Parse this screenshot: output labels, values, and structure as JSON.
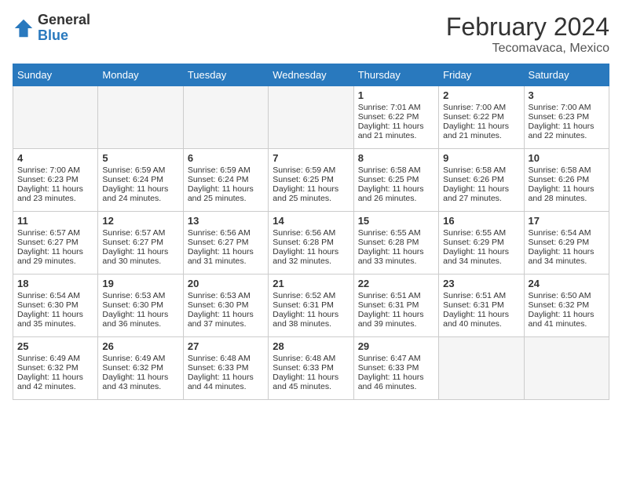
{
  "header": {
    "logo_line1": "General",
    "logo_line2": "Blue",
    "title": "February 2024",
    "subtitle": "Tecomavaca, Mexico"
  },
  "days_of_week": [
    "Sunday",
    "Monday",
    "Tuesday",
    "Wednesday",
    "Thursday",
    "Friday",
    "Saturday"
  ],
  "weeks": [
    [
      {
        "day": "",
        "info": ""
      },
      {
        "day": "",
        "info": ""
      },
      {
        "day": "",
        "info": ""
      },
      {
        "day": "",
        "info": ""
      },
      {
        "day": "1",
        "info": "Sunrise: 7:01 AM\nSunset: 6:22 PM\nDaylight: 11 hours and 21 minutes."
      },
      {
        "day": "2",
        "info": "Sunrise: 7:00 AM\nSunset: 6:22 PM\nDaylight: 11 hours and 21 minutes."
      },
      {
        "day": "3",
        "info": "Sunrise: 7:00 AM\nSunset: 6:23 PM\nDaylight: 11 hours and 22 minutes."
      }
    ],
    [
      {
        "day": "4",
        "info": "Sunrise: 7:00 AM\nSunset: 6:23 PM\nDaylight: 11 hours and 23 minutes."
      },
      {
        "day": "5",
        "info": "Sunrise: 6:59 AM\nSunset: 6:24 PM\nDaylight: 11 hours and 24 minutes."
      },
      {
        "day": "6",
        "info": "Sunrise: 6:59 AM\nSunset: 6:24 PM\nDaylight: 11 hours and 25 minutes."
      },
      {
        "day": "7",
        "info": "Sunrise: 6:59 AM\nSunset: 6:25 PM\nDaylight: 11 hours and 25 minutes."
      },
      {
        "day": "8",
        "info": "Sunrise: 6:58 AM\nSunset: 6:25 PM\nDaylight: 11 hours and 26 minutes."
      },
      {
        "day": "9",
        "info": "Sunrise: 6:58 AM\nSunset: 6:26 PM\nDaylight: 11 hours and 27 minutes."
      },
      {
        "day": "10",
        "info": "Sunrise: 6:58 AM\nSunset: 6:26 PM\nDaylight: 11 hours and 28 minutes."
      }
    ],
    [
      {
        "day": "11",
        "info": "Sunrise: 6:57 AM\nSunset: 6:27 PM\nDaylight: 11 hours and 29 minutes."
      },
      {
        "day": "12",
        "info": "Sunrise: 6:57 AM\nSunset: 6:27 PM\nDaylight: 11 hours and 30 minutes."
      },
      {
        "day": "13",
        "info": "Sunrise: 6:56 AM\nSunset: 6:27 PM\nDaylight: 11 hours and 31 minutes."
      },
      {
        "day": "14",
        "info": "Sunrise: 6:56 AM\nSunset: 6:28 PM\nDaylight: 11 hours and 32 minutes."
      },
      {
        "day": "15",
        "info": "Sunrise: 6:55 AM\nSunset: 6:28 PM\nDaylight: 11 hours and 33 minutes."
      },
      {
        "day": "16",
        "info": "Sunrise: 6:55 AM\nSunset: 6:29 PM\nDaylight: 11 hours and 34 minutes."
      },
      {
        "day": "17",
        "info": "Sunrise: 6:54 AM\nSunset: 6:29 PM\nDaylight: 11 hours and 34 minutes."
      }
    ],
    [
      {
        "day": "18",
        "info": "Sunrise: 6:54 AM\nSunset: 6:30 PM\nDaylight: 11 hours and 35 minutes."
      },
      {
        "day": "19",
        "info": "Sunrise: 6:53 AM\nSunset: 6:30 PM\nDaylight: 11 hours and 36 minutes."
      },
      {
        "day": "20",
        "info": "Sunrise: 6:53 AM\nSunset: 6:30 PM\nDaylight: 11 hours and 37 minutes."
      },
      {
        "day": "21",
        "info": "Sunrise: 6:52 AM\nSunset: 6:31 PM\nDaylight: 11 hours and 38 minutes."
      },
      {
        "day": "22",
        "info": "Sunrise: 6:51 AM\nSunset: 6:31 PM\nDaylight: 11 hours and 39 minutes."
      },
      {
        "day": "23",
        "info": "Sunrise: 6:51 AM\nSunset: 6:31 PM\nDaylight: 11 hours and 40 minutes."
      },
      {
        "day": "24",
        "info": "Sunrise: 6:50 AM\nSunset: 6:32 PM\nDaylight: 11 hours and 41 minutes."
      }
    ],
    [
      {
        "day": "25",
        "info": "Sunrise: 6:49 AM\nSunset: 6:32 PM\nDaylight: 11 hours and 42 minutes."
      },
      {
        "day": "26",
        "info": "Sunrise: 6:49 AM\nSunset: 6:32 PM\nDaylight: 11 hours and 43 minutes."
      },
      {
        "day": "27",
        "info": "Sunrise: 6:48 AM\nSunset: 6:33 PM\nDaylight: 11 hours and 44 minutes."
      },
      {
        "day": "28",
        "info": "Sunrise: 6:48 AM\nSunset: 6:33 PM\nDaylight: 11 hours and 45 minutes."
      },
      {
        "day": "29",
        "info": "Sunrise: 6:47 AM\nSunset: 6:33 PM\nDaylight: 11 hours and 46 minutes."
      },
      {
        "day": "",
        "info": ""
      },
      {
        "day": "",
        "info": ""
      }
    ]
  ]
}
